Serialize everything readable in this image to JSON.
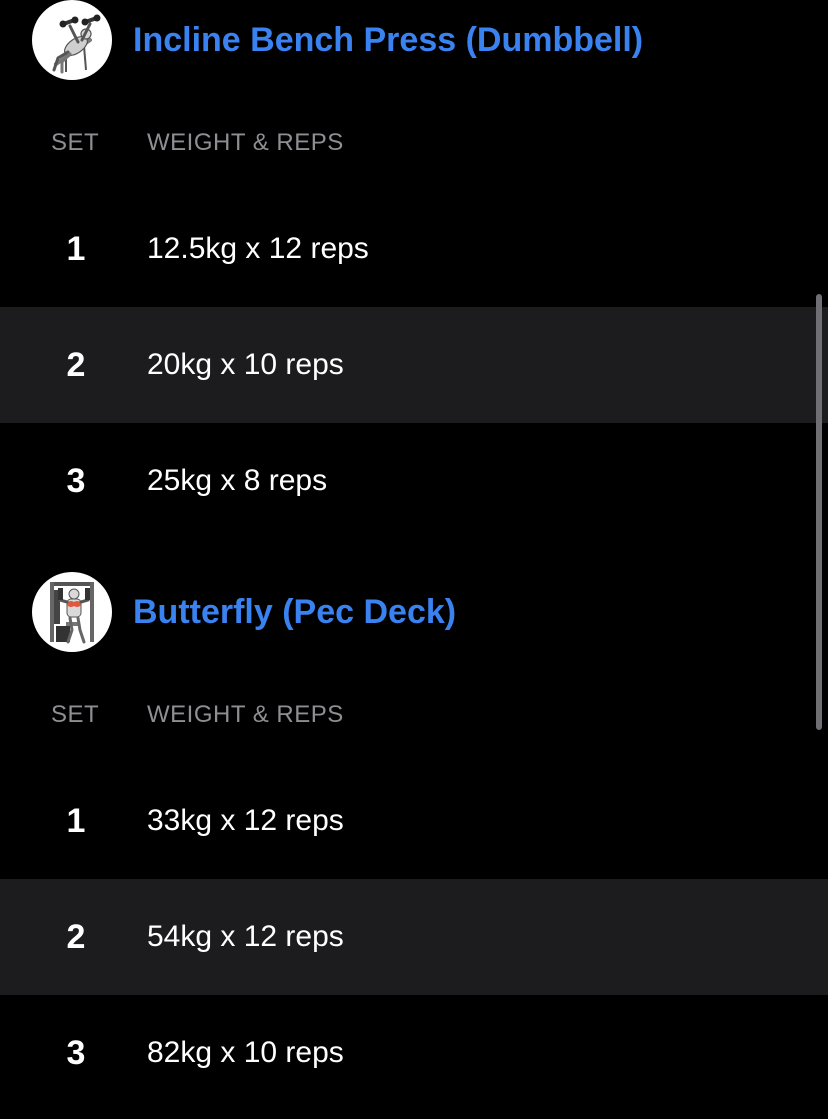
{
  "accent_color": "#3a82f0",
  "exercises": [
    {
      "title": "Incline Bench Press (Dumbbell)",
      "icon": "incline-bench-press-dumbbell-icon",
      "columns": {
        "set": "SET",
        "weight_reps": "WEIGHT & REPS"
      },
      "sets": [
        {
          "set": "1",
          "value": "12.5kg x 12 reps"
        },
        {
          "set": "2",
          "value": "20kg x 10 reps"
        },
        {
          "set": "3",
          "value": "25kg x 8 reps"
        }
      ]
    },
    {
      "title": "Butterfly (Pec Deck)",
      "icon": "butterfly-pec-deck-icon",
      "columns": {
        "set": "SET",
        "weight_reps": "WEIGHT & REPS"
      },
      "sets": [
        {
          "set": "1",
          "value": "33kg x 12 reps"
        },
        {
          "set": "2",
          "value": "54kg x 12 reps"
        },
        {
          "set": "3",
          "value": "82kg x 10 reps"
        }
      ]
    }
  ]
}
